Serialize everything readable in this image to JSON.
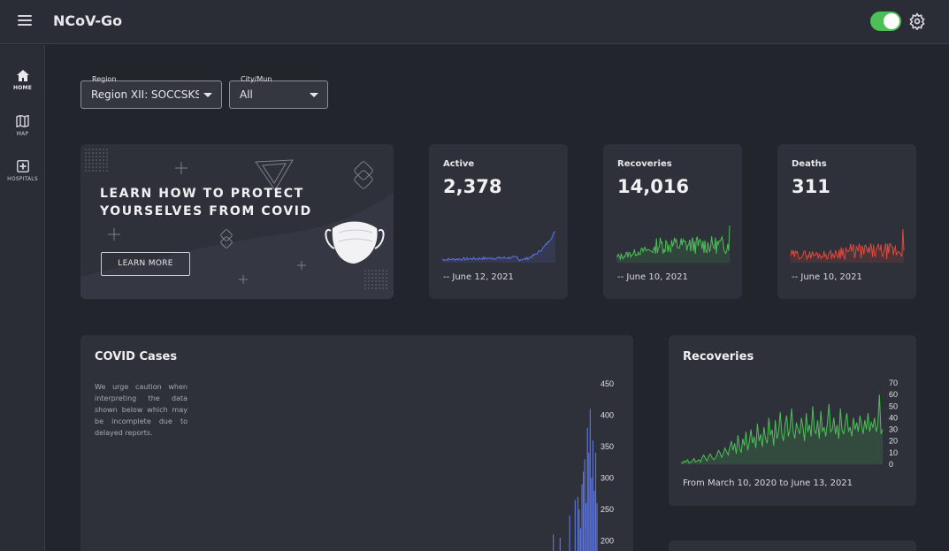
{
  "app": {
    "title": "NCoV-Go",
    "theme_dark_enabled": true
  },
  "header": {
    "menu_icon": "hamburger-icon",
    "settings_icon": "gear-icon"
  },
  "sidebar": {
    "items": [
      {
        "label": "HOME",
        "icon": "home-icon",
        "active": true
      },
      {
        "label": "MAP",
        "icon": "map-icon",
        "active": false
      },
      {
        "label": "HOSPITALS",
        "icon": "hospital-icon",
        "active": false
      }
    ]
  },
  "filters": {
    "region": {
      "label": "Region",
      "value": "Region XII: SOCCSKSARGEN"
    },
    "city": {
      "label": "City/Mun",
      "value": "All"
    }
  },
  "banner": {
    "title": "LEARN HOW TO PROTECT YOURSELVES FROM COVID",
    "button": "LEARN MORE"
  },
  "stats": [
    {
      "label": "Active",
      "value": "2,378",
      "date": "-- June 12, 2021",
      "color": "#5b74e4"
    },
    {
      "label": "Recoveries",
      "value": "14,016",
      "date": "-- June 10, 2021",
      "color": "#4cbf56"
    },
    {
      "label": "Deaths",
      "value": "311",
      "date": "-- June 10, 2021",
      "color": "#e0473a"
    }
  ],
  "cases": {
    "title": "COVID Cases",
    "note": "We urge caution when interpreting the data shown below which may be incomplete due to delayed reports."
  },
  "recoveries": {
    "title": "Recoveries",
    "range_text": "From March 10, 2020 to June 13, 2021"
  },
  "chart_data": [
    {
      "type": "bar",
      "title": "COVID Cases",
      "color": "#5b74e4",
      "yticks": [
        450,
        400,
        350,
        300,
        250,
        200
      ],
      "ylim": [
        0,
        450
      ],
      "values": [
        0,
        0,
        0,
        0,
        0,
        0,
        0,
        0,
        0,
        0,
        0,
        0,
        0,
        0,
        0,
        0,
        0,
        0,
        0,
        0,
        0,
        0,
        210,
        0,
        0,
        0,
        0,
        205,
        0,
        0,
        0,
        0,
        0,
        0,
        240,
        0,
        0,
        0,
        265,
        0,
        270,
        250,
        220,
        290,
        310,
        330,
        260,
        380,
        340,
        410,
        300,
        360,
        280,
        340,
        260
      ]
    },
    {
      "type": "area",
      "title": "Recoveries",
      "color": "#4cbf56",
      "yticks": [
        70,
        60,
        50,
        40,
        30,
        20,
        10,
        0
      ],
      "ylim": [
        0,
        70
      ],
      "values": [
        2,
        1,
        3,
        2,
        4,
        1,
        2,
        3,
        5,
        2,
        3,
        4,
        2,
        6,
        8,
        5,
        3,
        7,
        9,
        6,
        4,
        5,
        8,
        12,
        10,
        6,
        9,
        14,
        11,
        8,
        15,
        20,
        12,
        18,
        9,
        25,
        14,
        10,
        22,
        16,
        28,
        12,
        19,
        30,
        18,
        24,
        14,
        35,
        20,
        26,
        15,
        32,
        22,
        18,
        40,
        25,
        30,
        16,
        38,
        22,
        28,
        45,
        26,
        20,
        35,
        42,
        24,
        30,
        48,
        28,
        22,
        36,
        30,
        26,
        40,
        32,
        20,
        44,
        28,
        34,
        24,
        50,
        30,
        26,
        38,
        22,
        46,
        28,
        32,
        24,
        36,
        52,
        28,
        30,
        40,
        26,
        34,
        22,
        48,
        30,
        26,
        36,
        44,
        28,
        32,
        24,
        40,
        30,
        36,
        28,
        42,
        34,
        26,
        38,
        30,
        44,
        28,
        36,
        32,
        40,
        28,
        34,
        60,
        26,
        30
      ]
    }
  ]
}
